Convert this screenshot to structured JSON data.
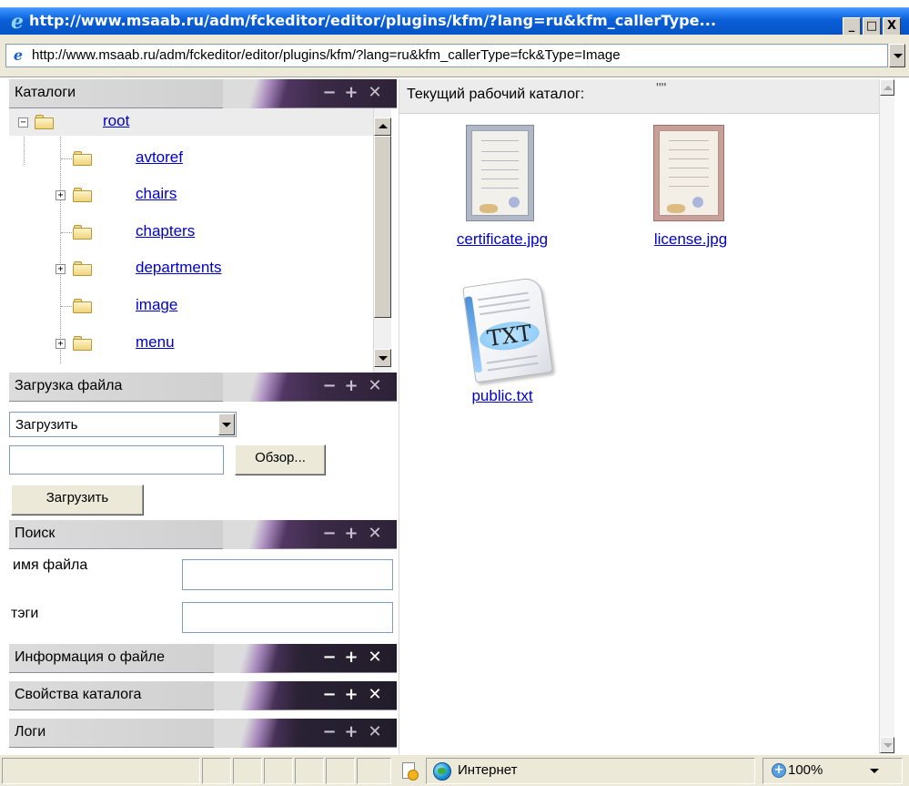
{
  "window": {
    "title": "http://www.msaab.ru/adm/fckeditor/editor/plugins/kfm/?lang=ru&kfm_callerType...",
    "buttons": {
      "minimize": "_",
      "maximize": "□",
      "close": "X"
    }
  },
  "address": {
    "url": "http://www.msaab.ru/adm/fckeditor/editor/plugins/kfm/?lang=ru&kfm_callerType=fck&Type=Image"
  },
  "panel_controls": {
    "minimize": "−",
    "expand": "+",
    "close": "✕"
  },
  "panels": {
    "catalogs": {
      "title": "Каталоги"
    },
    "upload": {
      "title": "Загрузка файла"
    },
    "search": {
      "title": "Поиск"
    },
    "file_info": {
      "title": "Информация о файле"
    },
    "dir_props": {
      "title": "Свойства каталога"
    },
    "logs": {
      "title": "Логи"
    }
  },
  "tree": {
    "root": {
      "label": "root",
      "expander": "−"
    },
    "items": [
      {
        "label": "avtoref",
        "expander": ""
      },
      {
        "label": "chairs",
        "expander": "+"
      },
      {
        "label": "chapters",
        "expander": ""
      },
      {
        "label": "departments",
        "expander": "+"
      },
      {
        "label": "image",
        "expander": ""
      },
      {
        "label": "menu",
        "expander": "+"
      }
    ]
  },
  "upload": {
    "mode_selected": "Загрузить",
    "browse_label": "Обзор...",
    "submit_label": "Загрузить"
  },
  "search": {
    "filename_label": "имя файла",
    "tags_label": "тэги",
    "filename_value": "",
    "tags_value": ""
  },
  "main": {
    "current_dir_label": "Текущий рабочий каталог:",
    "current_dir_value": "\"\"",
    "files": [
      {
        "name": "certificate.jpg",
        "kind": "certificate-image"
      },
      {
        "name": "license.jpg",
        "kind": "license-image"
      },
      {
        "name": "public.txt",
        "kind": "text-file",
        "badge": "TXT"
      }
    ]
  },
  "status": {
    "zone": "Интернет",
    "zoom": "100%"
  },
  "colors": {
    "titlebar": "#0a5fd8",
    "link": "#0000cc",
    "panel_header_dark": "#3b2a47",
    "chrome": "#ece9d8"
  }
}
